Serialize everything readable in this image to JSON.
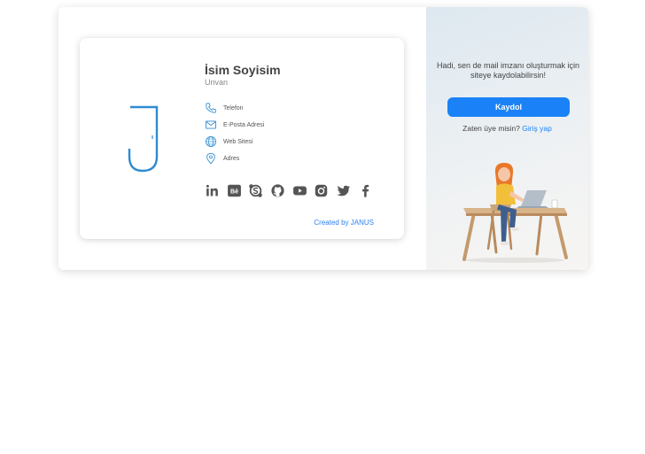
{
  "signature": {
    "name": "İsim Soyisim",
    "title": "Unvan",
    "contacts": [
      {
        "icon": "phone-icon",
        "label": "Telefon"
      },
      {
        "icon": "mail-icon",
        "label": "E-Posta Adresi"
      },
      {
        "icon": "globe-icon",
        "label": "Web Sitesi"
      },
      {
        "icon": "location-pin-icon",
        "label": "Adres"
      }
    ],
    "socials": [
      "linkedin-icon",
      "behance-icon",
      "skype-icon",
      "github-icon",
      "youtube-icon",
      "instagram-icon",
      "twitter-icon",
      "facebook-icon"
    ],
    "credit": "Created by JANUS",
    "logo_letter": "J",
    "accent_color": "#2f8bd1"
  },
  "register": {
    "prompt": "Hadi, sen de mail imzanı oluşturmak için siteye kaydolabilirsin!",
    "signup_label": "Kaydol",
    "member_question": "Zaten üye misin?",
    "login_link": "Giriş yap",
    "button_color": "#1a82f6"
  }
}
